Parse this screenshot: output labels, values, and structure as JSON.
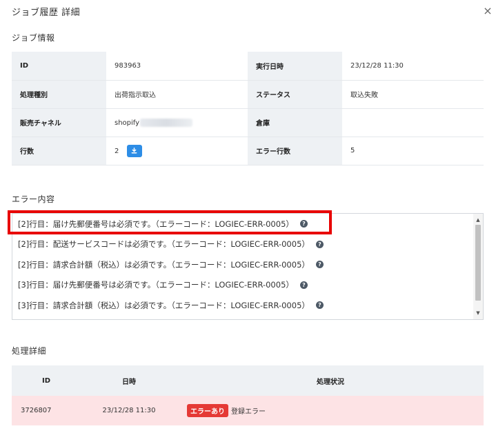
{
  "modal": {
    "title": "ジョブ履歴 詳細",
    "close_glyph": "×"
  },
  "job_info": {
    "section_title": "ジョブ情報",
    "rows": [
      {
        "label1": "ID",
        "value1": "983963",
        "label2": "実行日時",
        "value2": "23/12/28 11:30"
      },
      {
        "label1": "処理種別",
        "value1": "出荷指示取込",
        "label2": "ステータス",
        "value2": "取込失敗"
      },
      {
        "label1": "販売チャネル",
        "value1": "shopify",
        "label2": "倉庫",
        "value2": ""
      },
      {
        "label1": "行数",
        "value1": "2",
        "label2": "エラー行数",
        "value2": "5"
      }
    ],
    "download_icon": "download-icon"
  },
  "errors": {
    "section_title": "エラー内容",
    "help_glyph": "?",
    "items": [
      "[2]行目：届け先郵便番号は必須です。（エラーコード：LOGIEC-ERR-0005）",
      "[2]行目：配送サービスコードは必須です。（エラーコード：LOGIEC-ERR-0005）",
      "[2]行目：請求合計額（税込）は必須です。（エラーコード：LOGIEC-ERR-0005）",
      "[3]行目：届け先郵便番号は必須です。（エラーコード：LOGIEC-ERR-0005）",
      "[3]行目：請求合計額（税込）は必須です。（エラーコード：LOGIEC-ERR-0005）"
    ]
  },
  "process_detail": {
    "section_title": "処理詳細",
    "headers": [
      "ID",
      "日時",
      "処理状況"
    ],
    "rows": [
      {
        "id": "3726807",
        "datetime": "23/12/28 11:30",
        "badge": "エラーあり",
        "status": "登録エラー"
      }
    ]
  },
  "colors": {
    "accent": "#2d8de6",
    "highlight": "#e80000",
    "error_row": "#fde3e5",
    "badge": "#e53935"
  }
}
